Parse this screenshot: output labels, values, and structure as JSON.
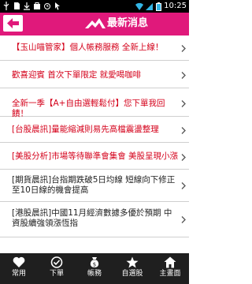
{
  "status_bar": {
    "time": "10:25"
  },
  "header": {
    "title": "最新消息",
    "accent_color": "#e0197b"
  },
  "news": [
    {
      "text": "【玉山喵管家】個人帳務服務 全新上線！",
      "color": "red"
    },
    {
      "text": "歡喜迎賓 首次下單限定 就愛喝咖啡",
      "color": "red"
    },
    {
      "text": "全新一季【A+自由選輕鬆付】您下單我回饋！",
      "color": "red"
    },
    {
      "text": "[台股晨訊]量能縮減則易先高檔震盪整理",
      "color": "red"
    },
    {
      "text": "[美股分析]市場等待聯準會集會 美股呈現小漲",
      "color": "red"
    },
    {
      "text": "[期貨晨訊]台指期跌破5日均線 短線向下修正至10日線的機會提高",
      "color": "black"
    },
    {
      "text": "[港股晨訊]中國11月經濟數據多優於預期 中資股續強領漲恆指",
      "color": "black"
    }
  ],
  "tabs": [
    {
      "label": "常用",
      "icon": "heart-icon"
    },
    {
      "label": "下單",
      "icon": "check-circle-icon"
    },
    {
      "label": "帳務",
      "icon": "money-bag-icon"
    },
    {
      "label": "自選股",
      "icon": "star-icon"
    },
    {
      "label": "主畫面",
      "icon": "home-icon"
    }
  ]
}
